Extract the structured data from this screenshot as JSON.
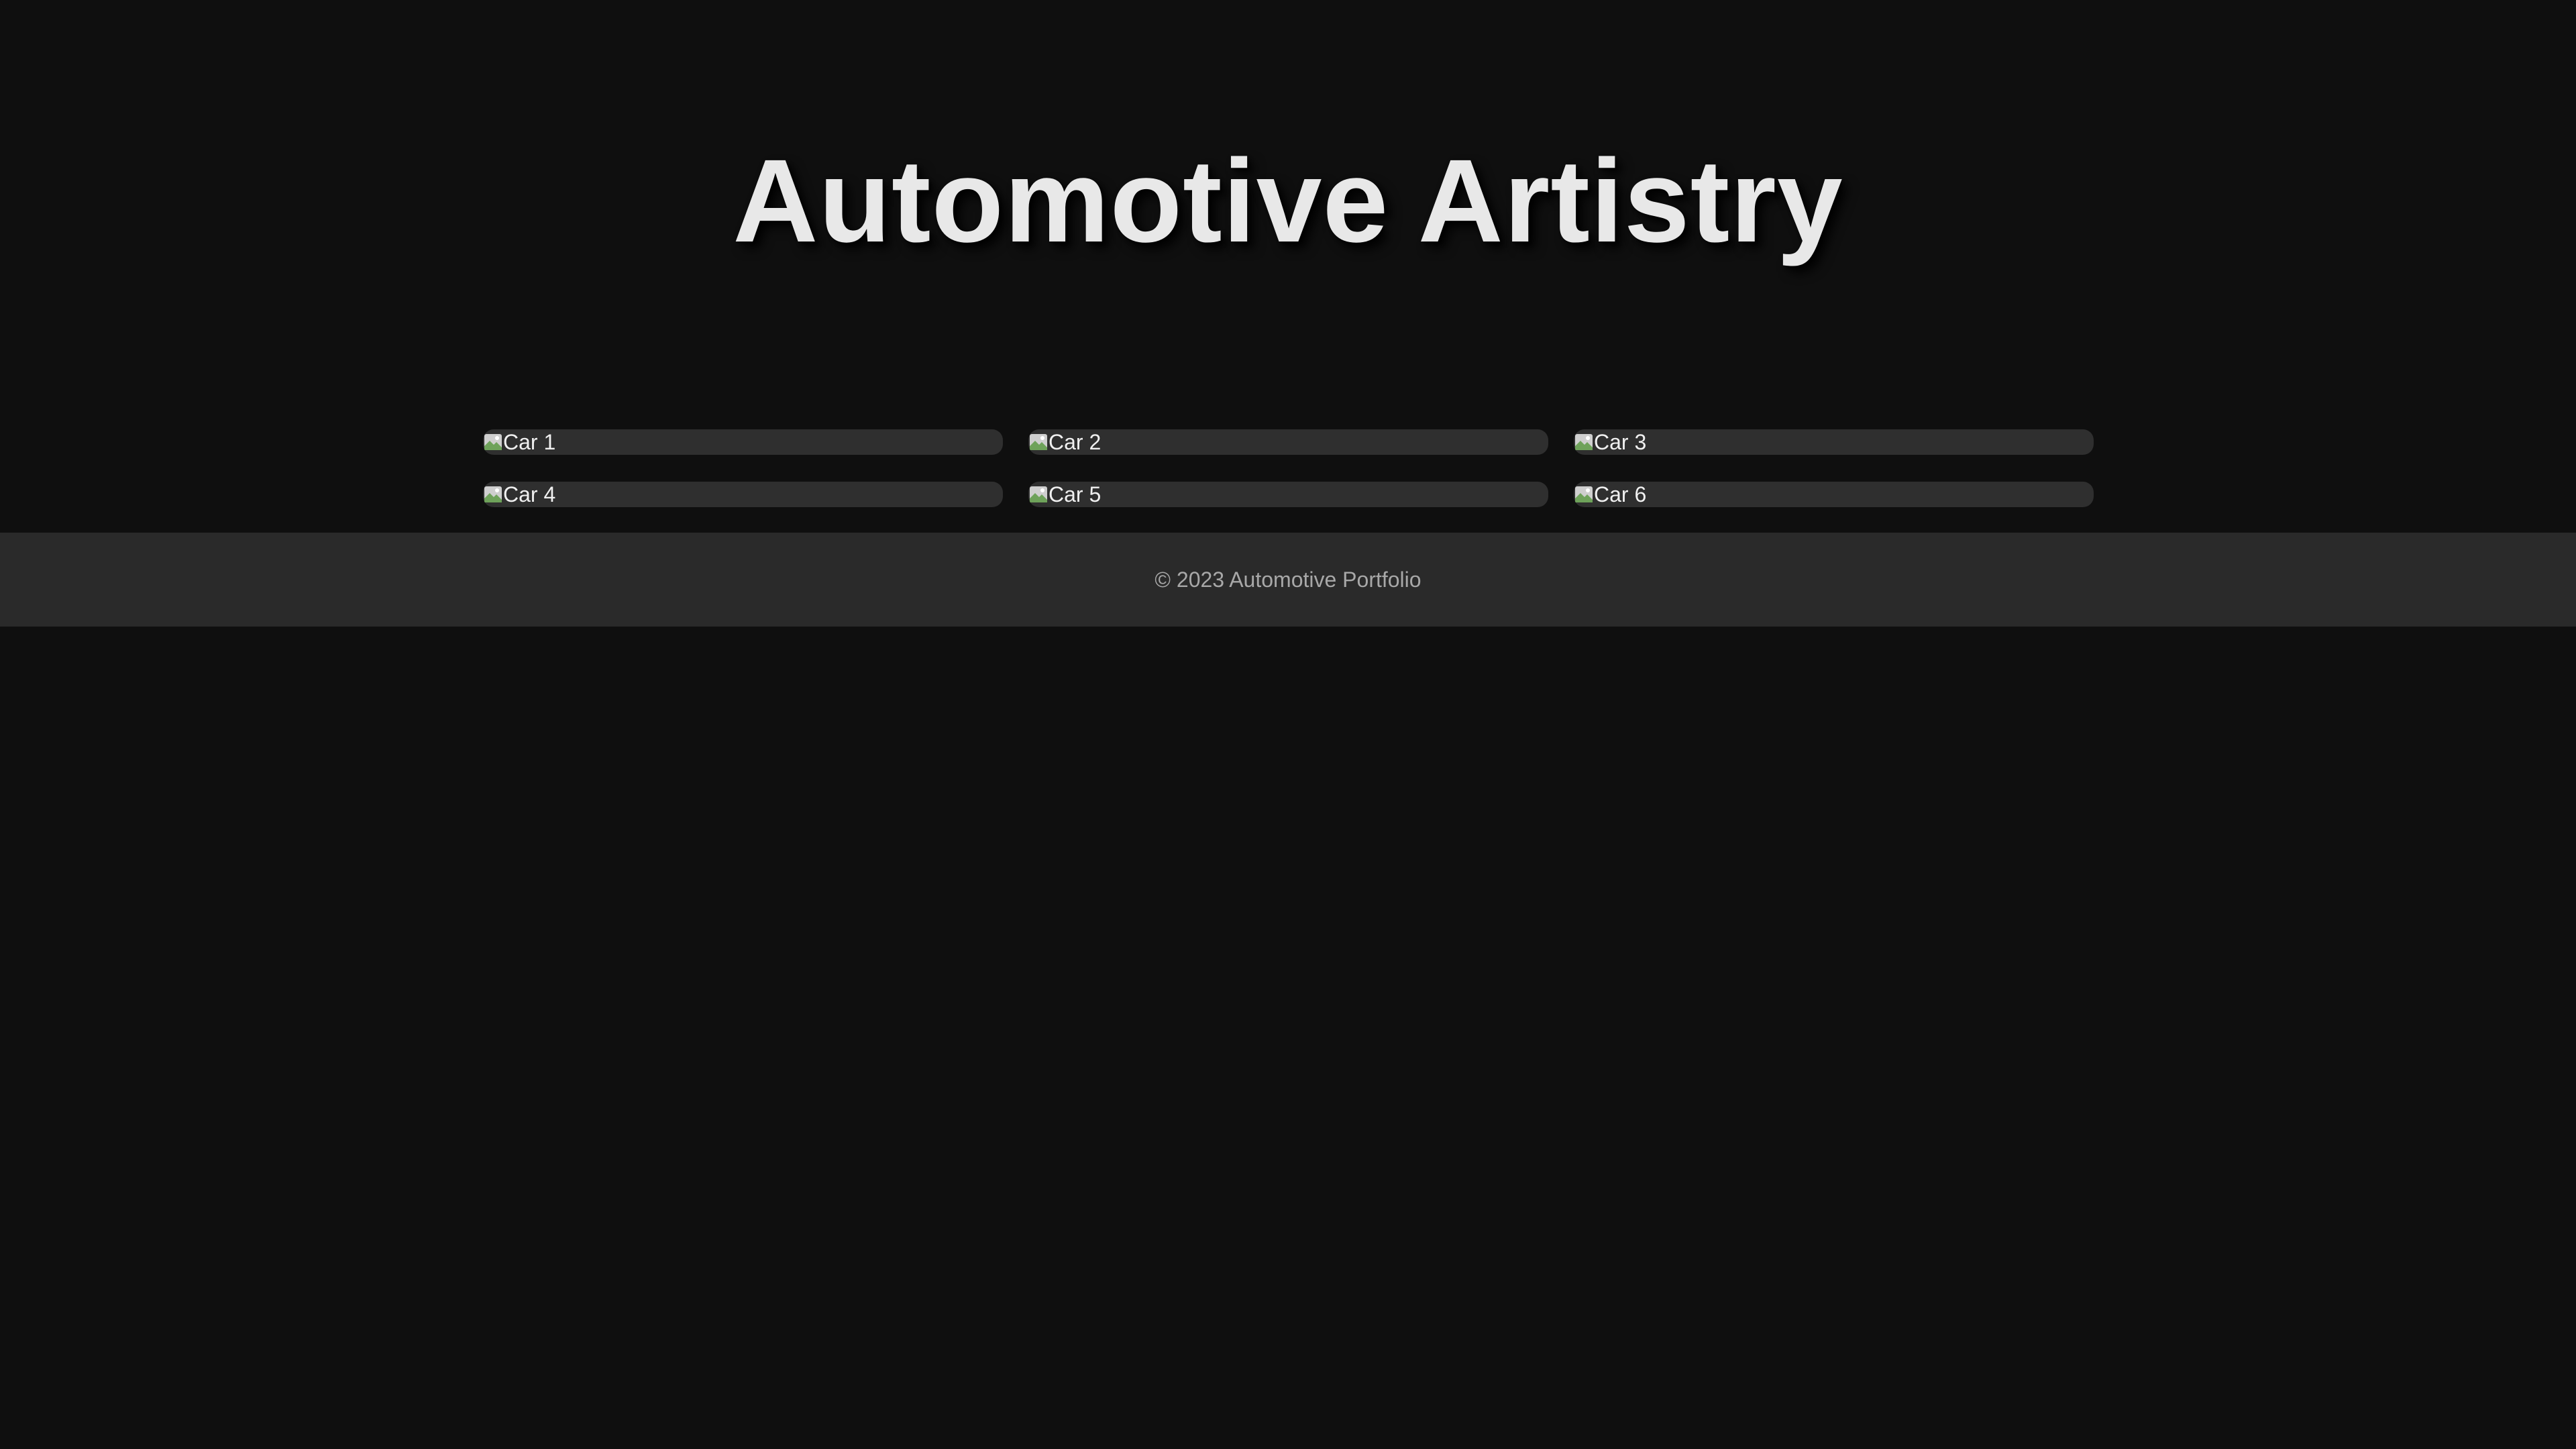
{
  "header": {
    "title": "Automotive Artistry"
  },
  "gallery": {
    "items": [
      {
        "alt": "Car 1"
      },
      {
        "alt": "Car 2"
      },
      {
        "alt": "Car 3"
      },
      {
        "alt": "Car 4"
      },
      {
        "alt": "Car 5"
      },
      {
        "alt": "Car 6"
      }
    ],
    "icon": "broken-image-icon"
  },
  "footer": {
    "text": "© 2023 Automotive Portfolio"
  },
  "colors": {
    "background": "#0f0f0f",
    "title": "#e8e8e8",
    "card": "#2f2f2f",
    "footer_bg": "#2a2a2a",
    "footer_text": "#a8a8a8"
  }
}
